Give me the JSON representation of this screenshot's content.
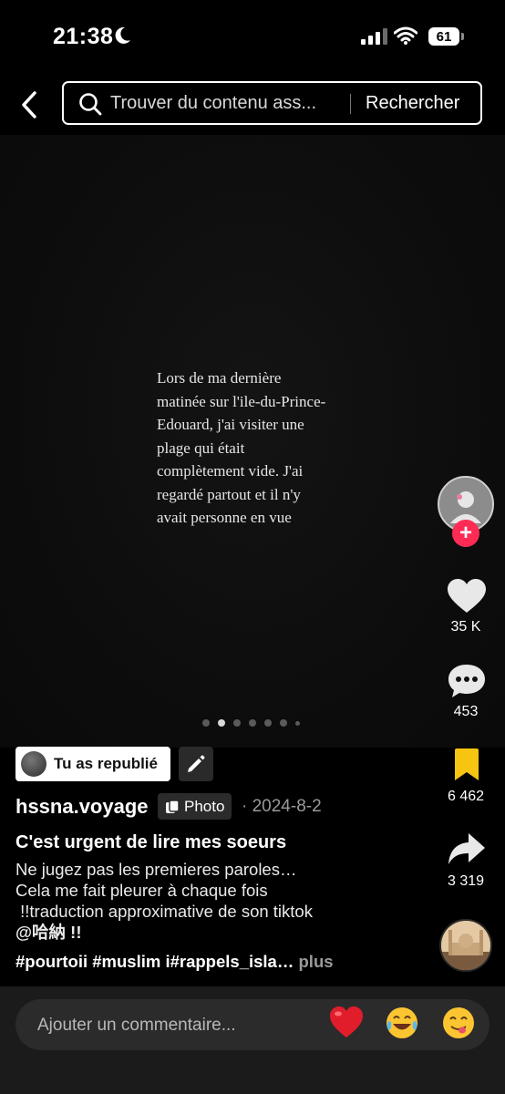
{
  "status_bar": {
    "time": "21:38",
    "battery": "61"
  },
  "search": {
    "placeholder": "Trouver du contenu ass...",
    "button": "Rechercher"
  },
  "post": {
    "quote_lines": [
      "Lors de ma dernière",
      "matinée sur l'ile-du-Prince-",
      "Edouard, j'ai visiter une",
      "plage qui était",
      "complètement vide. J'ai",
      "regardé partout et il n'y",
      "avait personne en vue"
    ],
    "carousel": {
      "total": 7,
      "active_index": 1
    }
  },
  "rail": {
    "likes": "35 K",
    "comments": "453",
    "saves": "6 462",
    "shares": "3 319",
    "colors": {
      "follow": "#fe2c55",
      "saved": "#f6c411"
    }
  },
  "caption": {
    "repost_label": "Tu as republié",
    "username": "hssna.voyage",
    "type_badge": "Photo",
    "date": "· 2024-8-2",
    "title": "C'est urgent de lire mes soeurs",
    "lines": [
      "Ne jugez pas les premieres paroles…",
      "Cela me fait pleurer à chaque fois",
      " !!traduction approximative de son tiktok",
      "@哈納 !!"
    ],
    "hashtags": "#pourtoii #muslim i#rappels_isla…",
    "more": "plus"
  },
  "comment_bar": {
    "placeholder": "Ajouter un commentaire...",
    "emojis": [
      "red-heart",
      "tears-of-joy",
      "yum-face"
    ]
  }
}
